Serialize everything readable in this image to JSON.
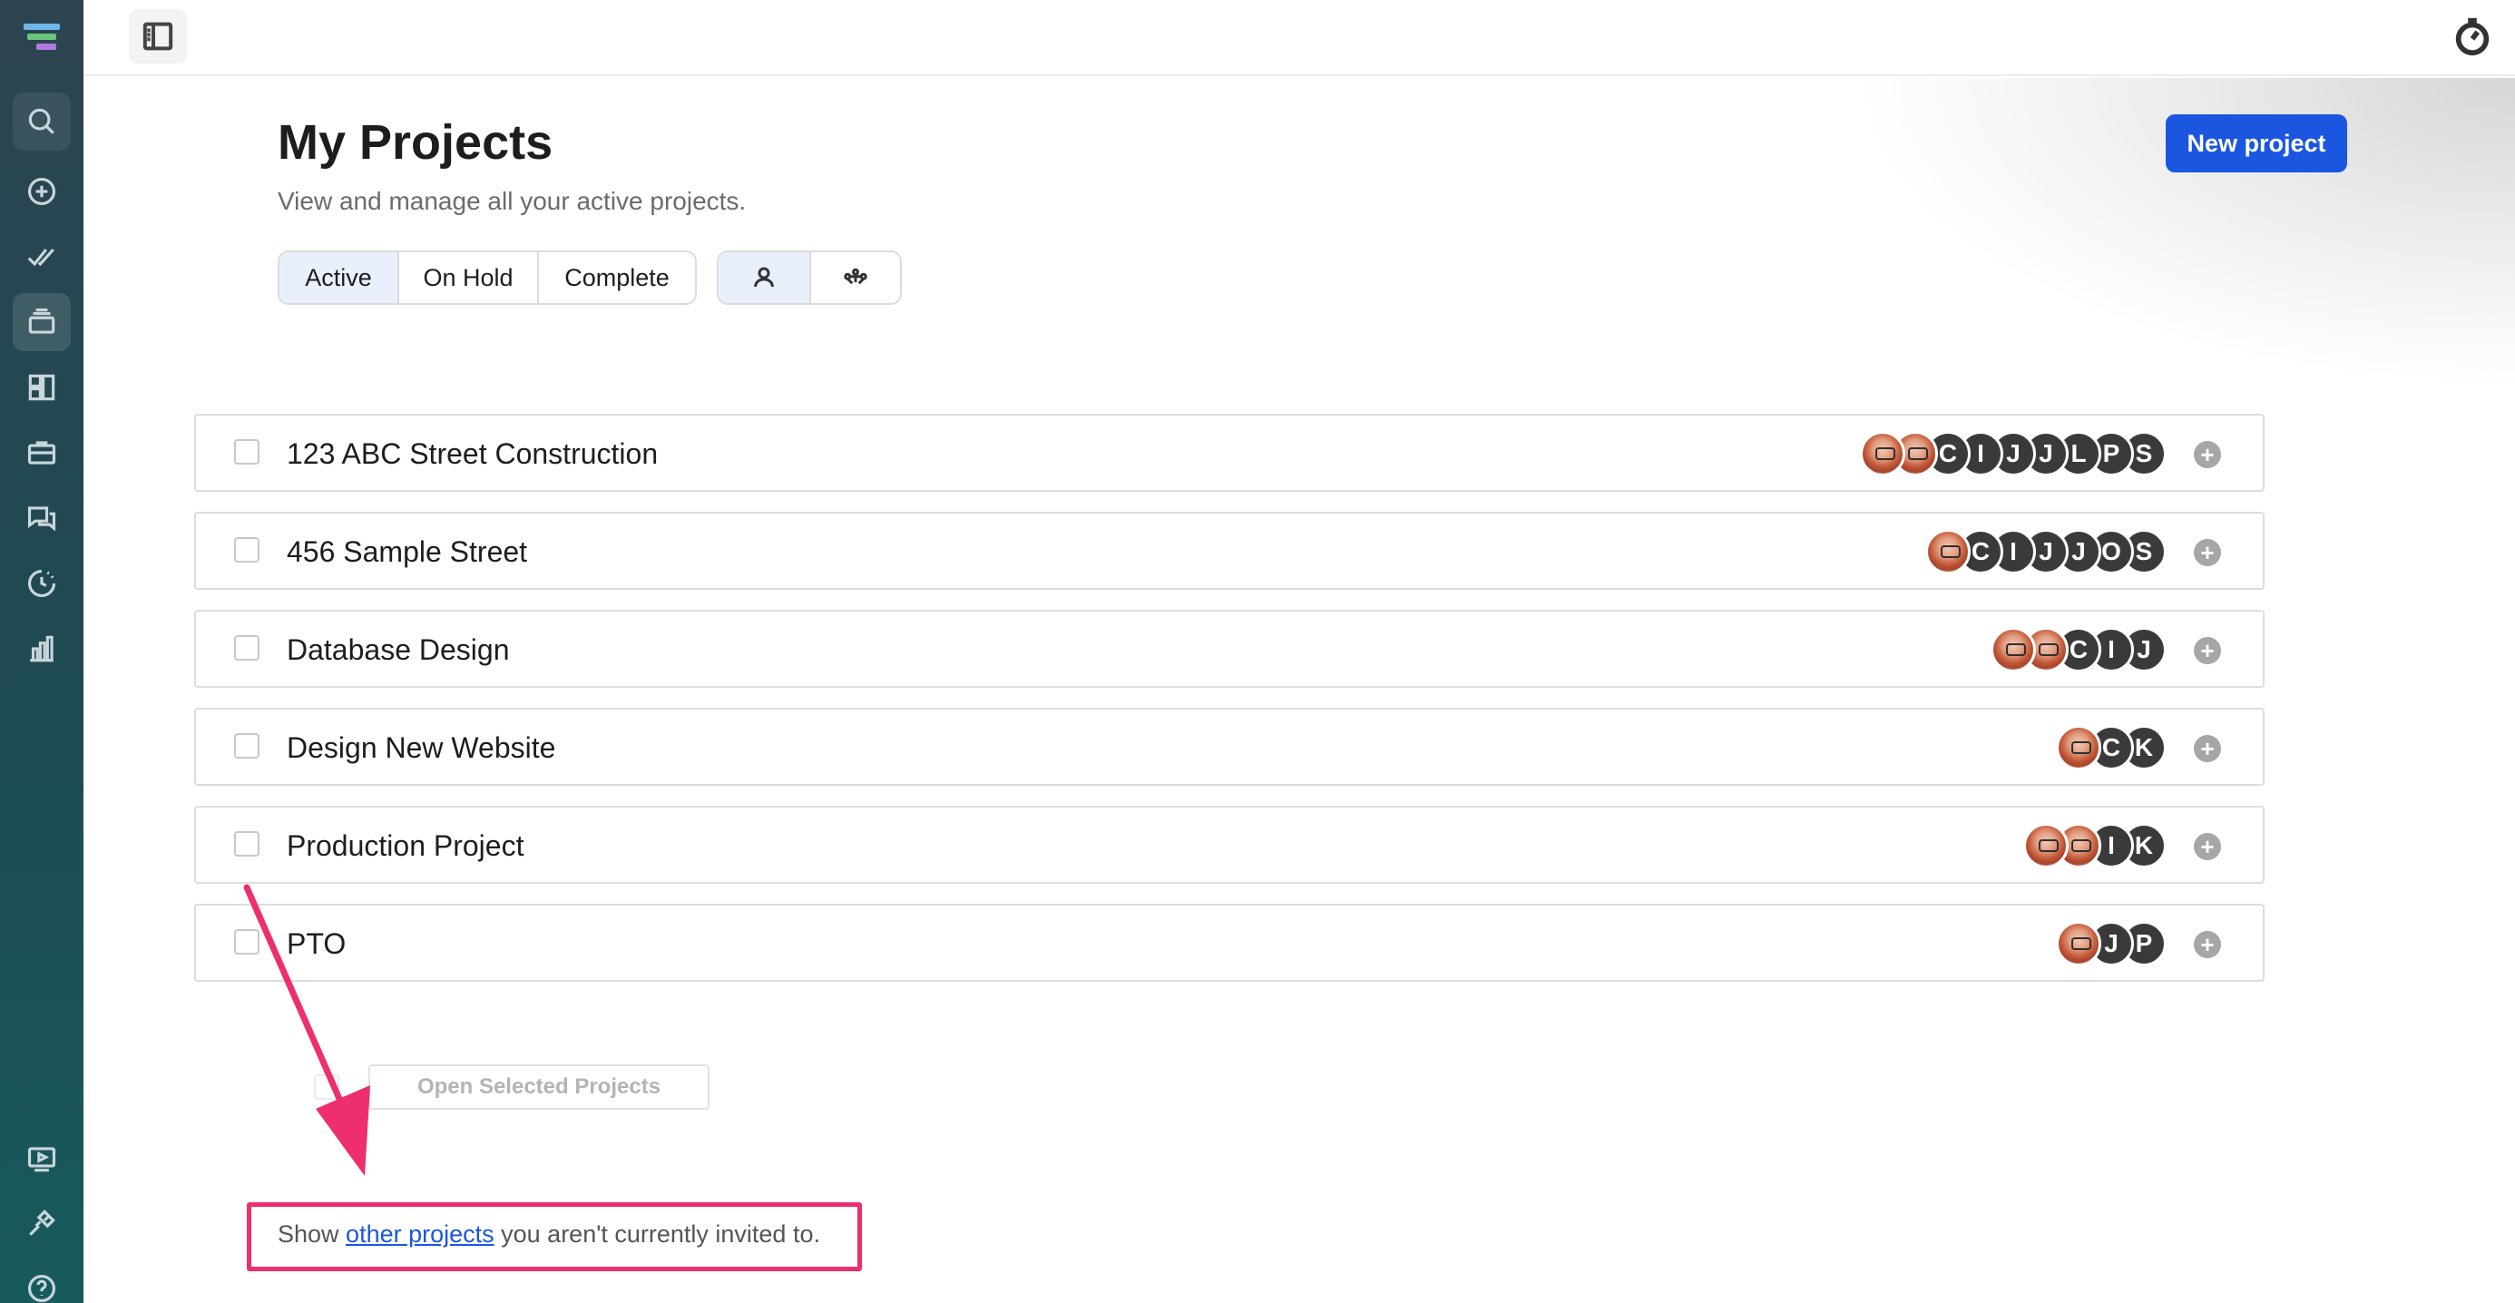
{
  "page": {
    "title": "My Projects",
    "subtitle": "View and manage all your active projects.",
    "new_button": "New project"
  },
  "filters": {
    "status_options": [
      "Active",
      "On Hold",
      "Complete"
    ],
    "selected_status": "Active",
    "view_icons": [
      "person-icon",
      "team-icon"
    ],
    "selected_view": "person-icon"
  },
  "projects": [
    {
      "name": "123 ABC Street Construction",
      "members": [
        "photo",
        "photo",
        "C",
        "I",
        "J",
        "J",
        "L",
        "P",
        "S"
      ]
    },
    {
      "name": "456 Sample Street",
      "members": [
        "photo",
        "C",
        "I",
        "J",
        "J",
        "O",
        "S"
      ]
    },
    {
      "name": "Database Design",
      "members": [
        "photo",
        "photo",
        "C",
        "I",
        "J"
      ]
    },
    {
      "name": "Design New Website",
      "members": [
        "photo",
        "C",
        "K"
      ]
    },
    {
      "name": "Production Project",
      "members": [
        "photo",
        "photo",
        "I",
        "K"
      ]
    },
    {
      "name": "PTO",
      "members": [
        "photo",
        "J",
        "P"
      ]
    }
  ],
  "actions": {
    "open_selected": "Open Selected Projects"
  },
  "footer": {
    "prefix": "Show ",
    "link": "other projects",
    "suffix": " you aren't currently invited to."
  },
  "sidebar": {
    "icons": [
      "search-icon",
      "add-icon",
      "tasks-icon",
      "projects-icon",
      "boards-icon",
      "portfolio-icon",
      "messages-icon",
      "timesheet-icon",
      "reports-icon",
      "video-icon",
      "integrations-icon",
      "help-icon"
    ],
    "active": "projects-icon"
  },
  "colors": {
    "accent": "#1a56e0",
    "annotation": "#ee2f6e"
  }
}
